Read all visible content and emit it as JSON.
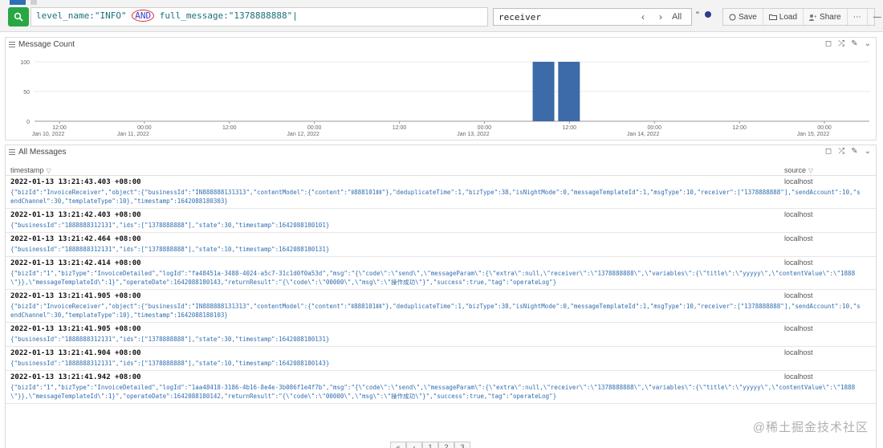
{
  "query": {
    "part1": "level_name:\"INFO\" ",
    "and": "AND",
    "part2": " full_message:\"1378888888\"|"
  },
  "find": {
    "value": "receiver",
    "prev": "‹",
    "next": "›",
    "all": "All",
    "option": "\""
  },
  "toolbar": {
    "save": "Save",
    "load": "Load",
    "share": "Share",
    "more": "⋯",
    "collapse": "—"
  },
  "message_count_panel": {
    "title": "Message Count"
  },
  "chart_data": {
    "type": "bar",
    "yticks": [
      "100",
      "50",
      "0"
    ],
    "ylim": [
      0,
      100
    ],
    "xticks": [
      {
        "time": "12:00",
        "date": "Jan 10, 2022"
      },
      {
        "time": "00:00",
        "date": "Jan 11, 2022"
      },
      {
        "time": "12:00",
        "date": ""
      },
      {
        "time": "00:00",
        "date": "Jan 12, 2022"
      },
      {
        "time": "12:00",
        "date": ""
      },
      {
        "time": "00:00",
        "date": "Jan 13, 2022"
      },
      {
        "time": "12:00",
        "date": ""
      },
      {
        "time": "00:00",
        "date": "Jan 14, 2022"
      },
      {
        "time": "12:00",
        "date": ""
      },
      {
        "time": "00:00",
        "date": "Jan 15, 2022"
      }
    ],
    "bars": [
      {
        "tick_position": 5.7,
        "value": 100
      },
      {
        "tick_position": 6.0,
        "value": 100
      }
    ],
    "bar_color": "#3d6aa8"
  },
  "all_messages_panel": {
    "title": "All Messages",
    "col_timestamp": "timestamp",
    "col_source": "source",
    "sort_glyph": "▽"
  },
  "rows": [
    {
      "ts": "2022-01-13 13:21:43.403 +08:00",
      "source": "localhost",
      "msg": "{\"bizId\":\"InvoiceReceiver\",\"object\":{\"businessId\":\"IN888888131313\",\"contentModel\":{\"content\":\"Ⅱ888101ⅡⅡ\"},\"deduplicateTime\":1,\"bizType\":38,\"isNightMode\":0,\"messageTemplateId\":1,\"msgType\":10,\"receiver\":[\"1378888888\"],\"sendAccount\":10,\"sendChannel\":30,\"templateType\":10},\"timestamp\":1642088180303}"
    },
    {
      "ts": "2022-01-13 13:21:42.403 +08:00",
      "source": "localhost",
      "msg": "{\"businessId\":\"1888888312131\",\"ids\":[\"1378888888\"],\"state\":30,\"timestamp\":1642088180101}"
    },
    {
      "ts": "2022-01-13 13:21:42.464 +08:00",
      "source": "localhost",
      "msg": "{\"businessId\":\"1888888312131\",\"ids\":[\"1378888888\"],\"state\":10,\"timestamp\":1642088180131}"
    },
    {
      "ts": "2022-01-13 13:21:42.414 +08:00",
      "source": "localhost",
      "msg": "{\"bizId\":\"1\",\"bizType\":\"InvoiceDetailed\",\"logId\":\"fa48451a-3488-4024-a5c7-31c1d0f0a53d\",\"msg\":\"{\\\"code\\\":\\\"send\\\",\\\"messageParam\\\":{\\\"extra\\\":null,\\\"receiver\\\":\\\"1378888888\\\",\\\"variables\\\":{\\\"title\\\":\\\"yyyyy\\\",\\\"contentValue\\\":\\\"1888\\\"}},\\\"messageTemplateId\\\":1}\",\"operateDate\":1642088180143,\"returnResult\":\"{\\\"code\\\":\\\"00000\\\",\\\"msg\\\":\\\"操作成功\\\"}\",\"success\":true,\"tag\":\"operateLog\"}"
    },
    {
      "ts": "2022-01-13 13:21:41.905 +08:00",
      "source": "localhost",
      "msg": "{\"bizId\":\"InvoiceReceiver\",\"object\":{\"businessId\":\"IN888888131313\",\"contentModel\":{\"content\":\"Ⅱ888101ⅡⅡ\"},\"deduplicateTime\":1,\"bizType\":38,\"isNightMode\":0,\"messageTemplateId\":1,\"msgType\":10,\"receiver\":[\"1378888888\"],\"sendAccount\":10,\"sendChannel\":30,\"templateType\":10},\"timestamp\":1642088180103}"
    },
    {
      "ts": "2022-01-13 13:21:41.905 +08:00",
      "source": "localhost",
      "msg": "{\"businessId\":\"1888888312131\",\"ids\":[\"1378888888\"],\"state\":30,\"timestamp\":1642088180131}"
    },
    {
      "ts": "2022-01-13 13:21:41.904 +08:00",
      "source": "localhost",
      "msg": "{\"businessId\":\"1888888312131\",\"ids\":[\"1378888888\"],\"state\":10,\"timestamp\":1642088180143}"
    },
    {
      "ts": "2022-01-13 13:21:41.942 +08:00",
      "source": "localhost",
      "msg": "{\"bizId\":\"1\",\"bizType\":\"InvoiceDetailed\",\"logId\":\"1aa48418-3186-4b16-8e4e-3b086f1e4f7b\",\"msg\":\"{\\\"code\\\":\\\"send\\\",\\\"messageParam\\\":{\\\"extra\\\":null,\\\"receiver\\\":\\\"1378888888\\\",\\\"variables\\\":{\\\"title\\\":\\\"yyyyy\\\",\\\"contentValue\\\":\\\"1888\\\"}},\\\"messageTemplateId\\\":1}\",\"operateDate\":1642088180142,\"returnResult\":\"{\\\"code\\\":\\\"00000\\\",\\\"msg\\\":\\\"操作成功\\\"}\",\"success\":true,\"tag\":\"operateLog\"}"
    }
  ],
  "pager": [
    "«",
    "‹",
    "1",
    "2",
    "3"
  ],
  "watermark": "@稀土掘金技术社区",
  "colors": {
    "search_button": "#28a745",
    "and_circle": "#e0262b",
    "accent_blue": "#2f6fb5"
  }
}
